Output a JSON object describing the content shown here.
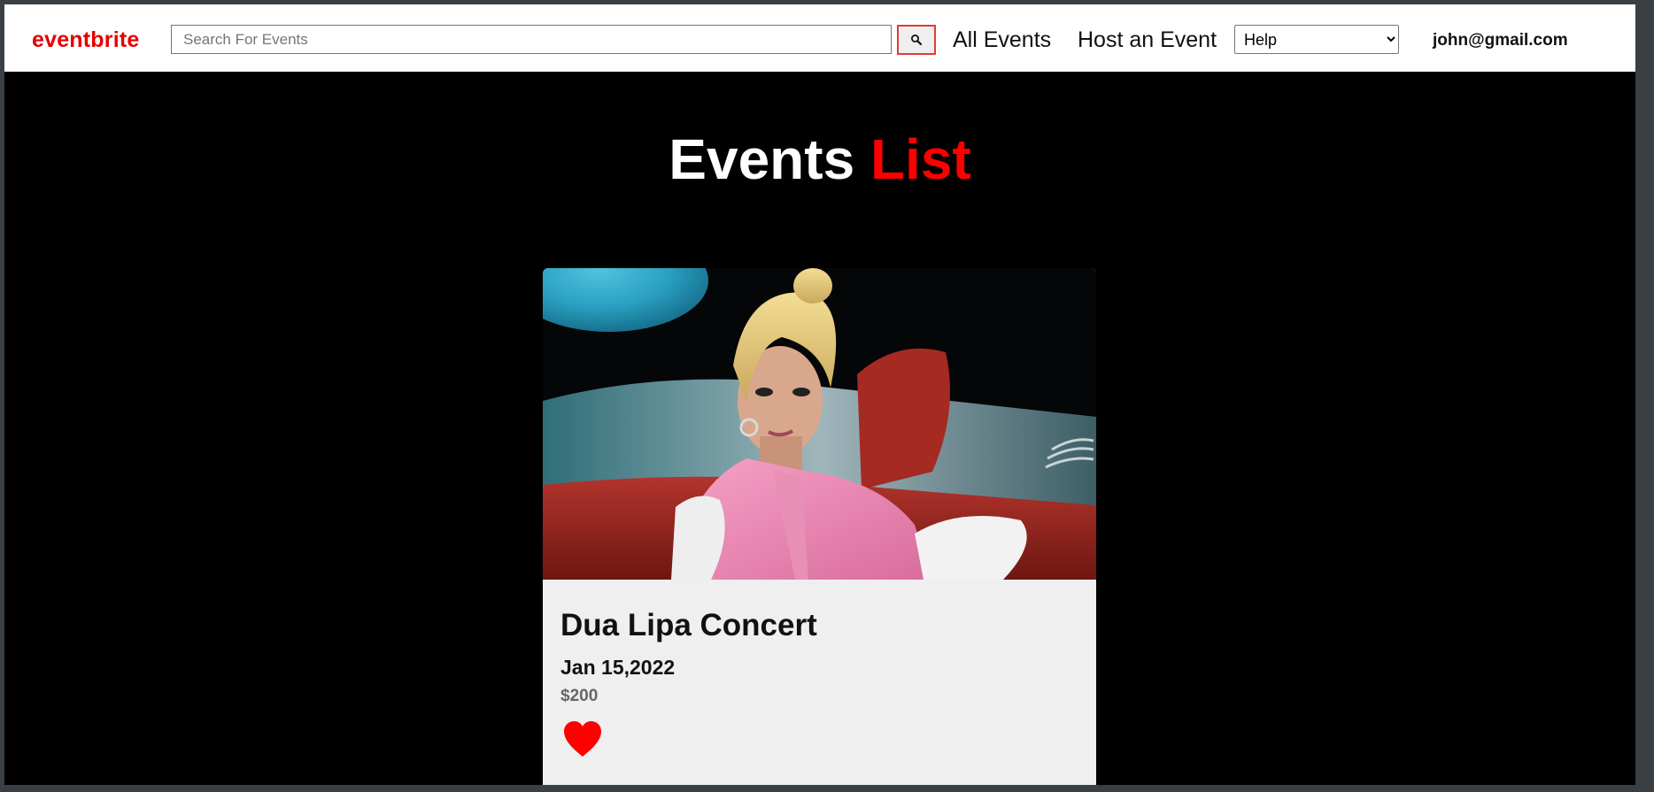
{
  "header": {
    "brand": "eventbrite",
    "search": {
      "placeholder": "Search For Events",
      "value": ""
    },
    "search_button_icon": "search-icon",
    "nav": {
      "all_events": "All Events",
      "host_event": "Host an Event"
    },
    "help_select": {
      "selected": "Help",
      "options": [
        "Help"
      ]
    },
    "user_email": "john@gmail.com"
  },
  "page": {
    "title_main": "Events",
    "title_accent": "List"
  },
  "events": [
    {
      "name": "Dua Lipa Concert",
      "date": "Jan 15,2022",
      "price": "$200",
      "favorite_icon": "heart-icon"
    }
  ],
  "colors": {
    "brand": "#e60000",
    "accent": "#ff0000",
    "page_background": "#000000",
    "card_background": "#efefef",
    "price_text": "#666666"
  }
}
